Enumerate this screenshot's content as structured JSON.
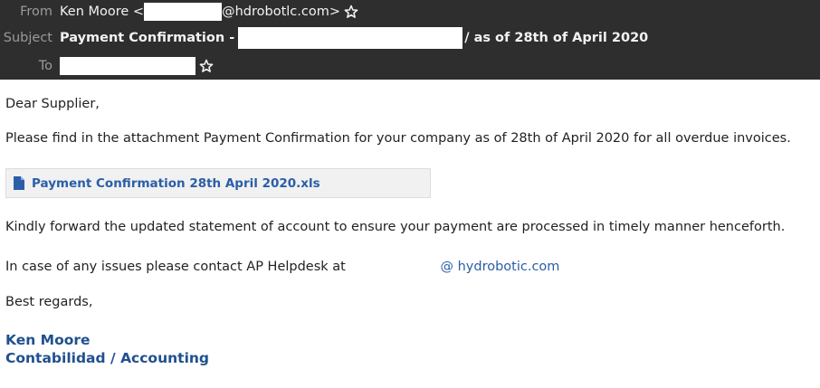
{
  "header": {
    "from_label": "From",
    "from_name": "Ken Moore <",
    "from_domain": "@hdrobotlc.com>",
    "subject_label": "Subject",
    "subject_prefix": "Payment Confirmation -",
    "subject_suffix": "/ as of 28th of April 2020",
    "to_label": "To"
  },
  "body": {
    "greeting": "Dear Supplier,",
    "intro": "Please find in the attachment Payment Confirmation for your company as of 28th of April 2020 for all overdue invoices.",
    "attachment_name": "Payment Confirmation 28th April 2020.xls",
    "forward_request": "Kindly forward the updated statement of account to ensure your payment are processed in timely manner henceforth.",
    "contact_text": "In case of any issues please contact AP Helpdesk at",
    "contact_domain": "@ hydrobotic.com",
    "closing": "Best regards,"
  },
  "signature": {
    "name": "Ken Moore",
    "title": "Contabilidad / Accounting"
  },
  "colors": {
    "header_bg": "#2e2e2e",
    "link": "#2a5ea8",
    "signature": "#20508f"
  },
  "icons": {
    "star": "star-icon",
    "attachment": "file-icon"
  }
}
